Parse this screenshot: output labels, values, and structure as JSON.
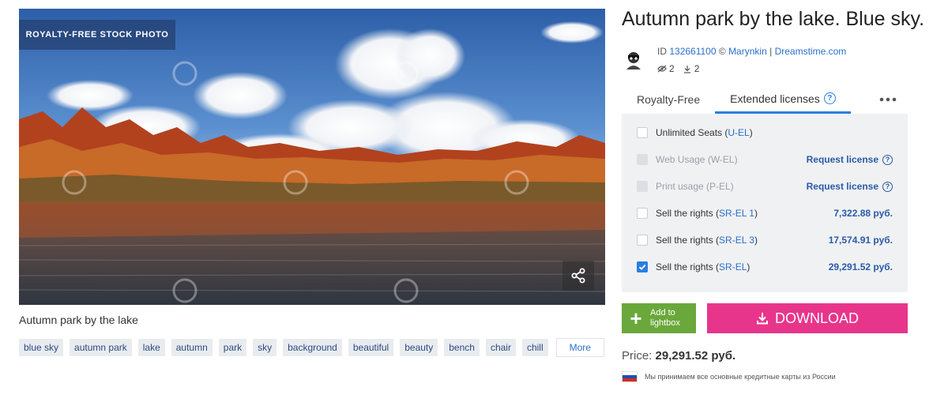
{
  "photo": {
    "badge": "ROYALTY-FREE STOCK PHOTO",
    "watermark": "dreamstime",
    "caption": "Autumn park by the lake"
  },
  "tags": [
    "blue sky",
    "autumn park",
    "lake",
    "autumn",
    "park",
    "sky",
    "background",
    "beautiful",
    "beauty",
    "bench",
    "chair",
    "chill"
  ],
  "more_label": "More",
  "title": "Autumn park by the lake. Blue sky.",
  "meta": {
    "id_prefix": "ID",
    "id": "132661100",
    "copyright": "©",
    "author": "Marynkin",
    "sep": "|",
    "site": "Dreamstime.com"
  },
  "stats": {
    "views": "2",
    "downloads": "2"
  },
  "tabs": {
    "royalty_free": "Royalty-Free",
    "extended": "Extended licenses"
  },
  "licenses": [
    {
      "label": "Unlimited Seats (",
      "code": "U-EL",
      "tail": ")",
      "right": "",
      "state": "unchecked"
    },
    {
      "label": "Web Usage (",
      "code": "W-EL",
      "tail": ")",
      "right": "Request license",
      "state": "disabled"
    },
    {
      "label": "Print usage (",
      "code": "P-EL",
      "tail": ")",
      "right": "Request license",
      "state": "disabled"
    },
    {
      "label": "Sell the rights (",
      "code": "SR-EL 1",
      "tail": ")",
      "right": "7,322.88 руб.",
      "state": "unchecked"
    },
    {
      "label": "Sell the rights (",
      "code": "SR-EL 3",
      "tail": ")",
      "right": "17,574.91 руб.",
      "state": "unchecked"
    },
    {
      "label": "Sell the rights (",
      "code": "SR-EL",
      "tail": ")",
      "right": "29,291.52 руб.",
      "state": "checked"
    }
  ],
  "lightbox": {
    "line1": "Add to",
    "line2": "lightbox"
  },
  "download_label": "DOWNLOAD",
  "price": {
    "label": "Price:",
    "value": "29,291.52 руб."
  },
  "cards_note": "Мы принимаем все основные кредитные карты из России",
  "colors": {
    "download": "#e8358c",
    "lightbox": "#6aa83b",
    "accent": "#2a7ee0",
    "link": "#2a6fc9"
  }
}
